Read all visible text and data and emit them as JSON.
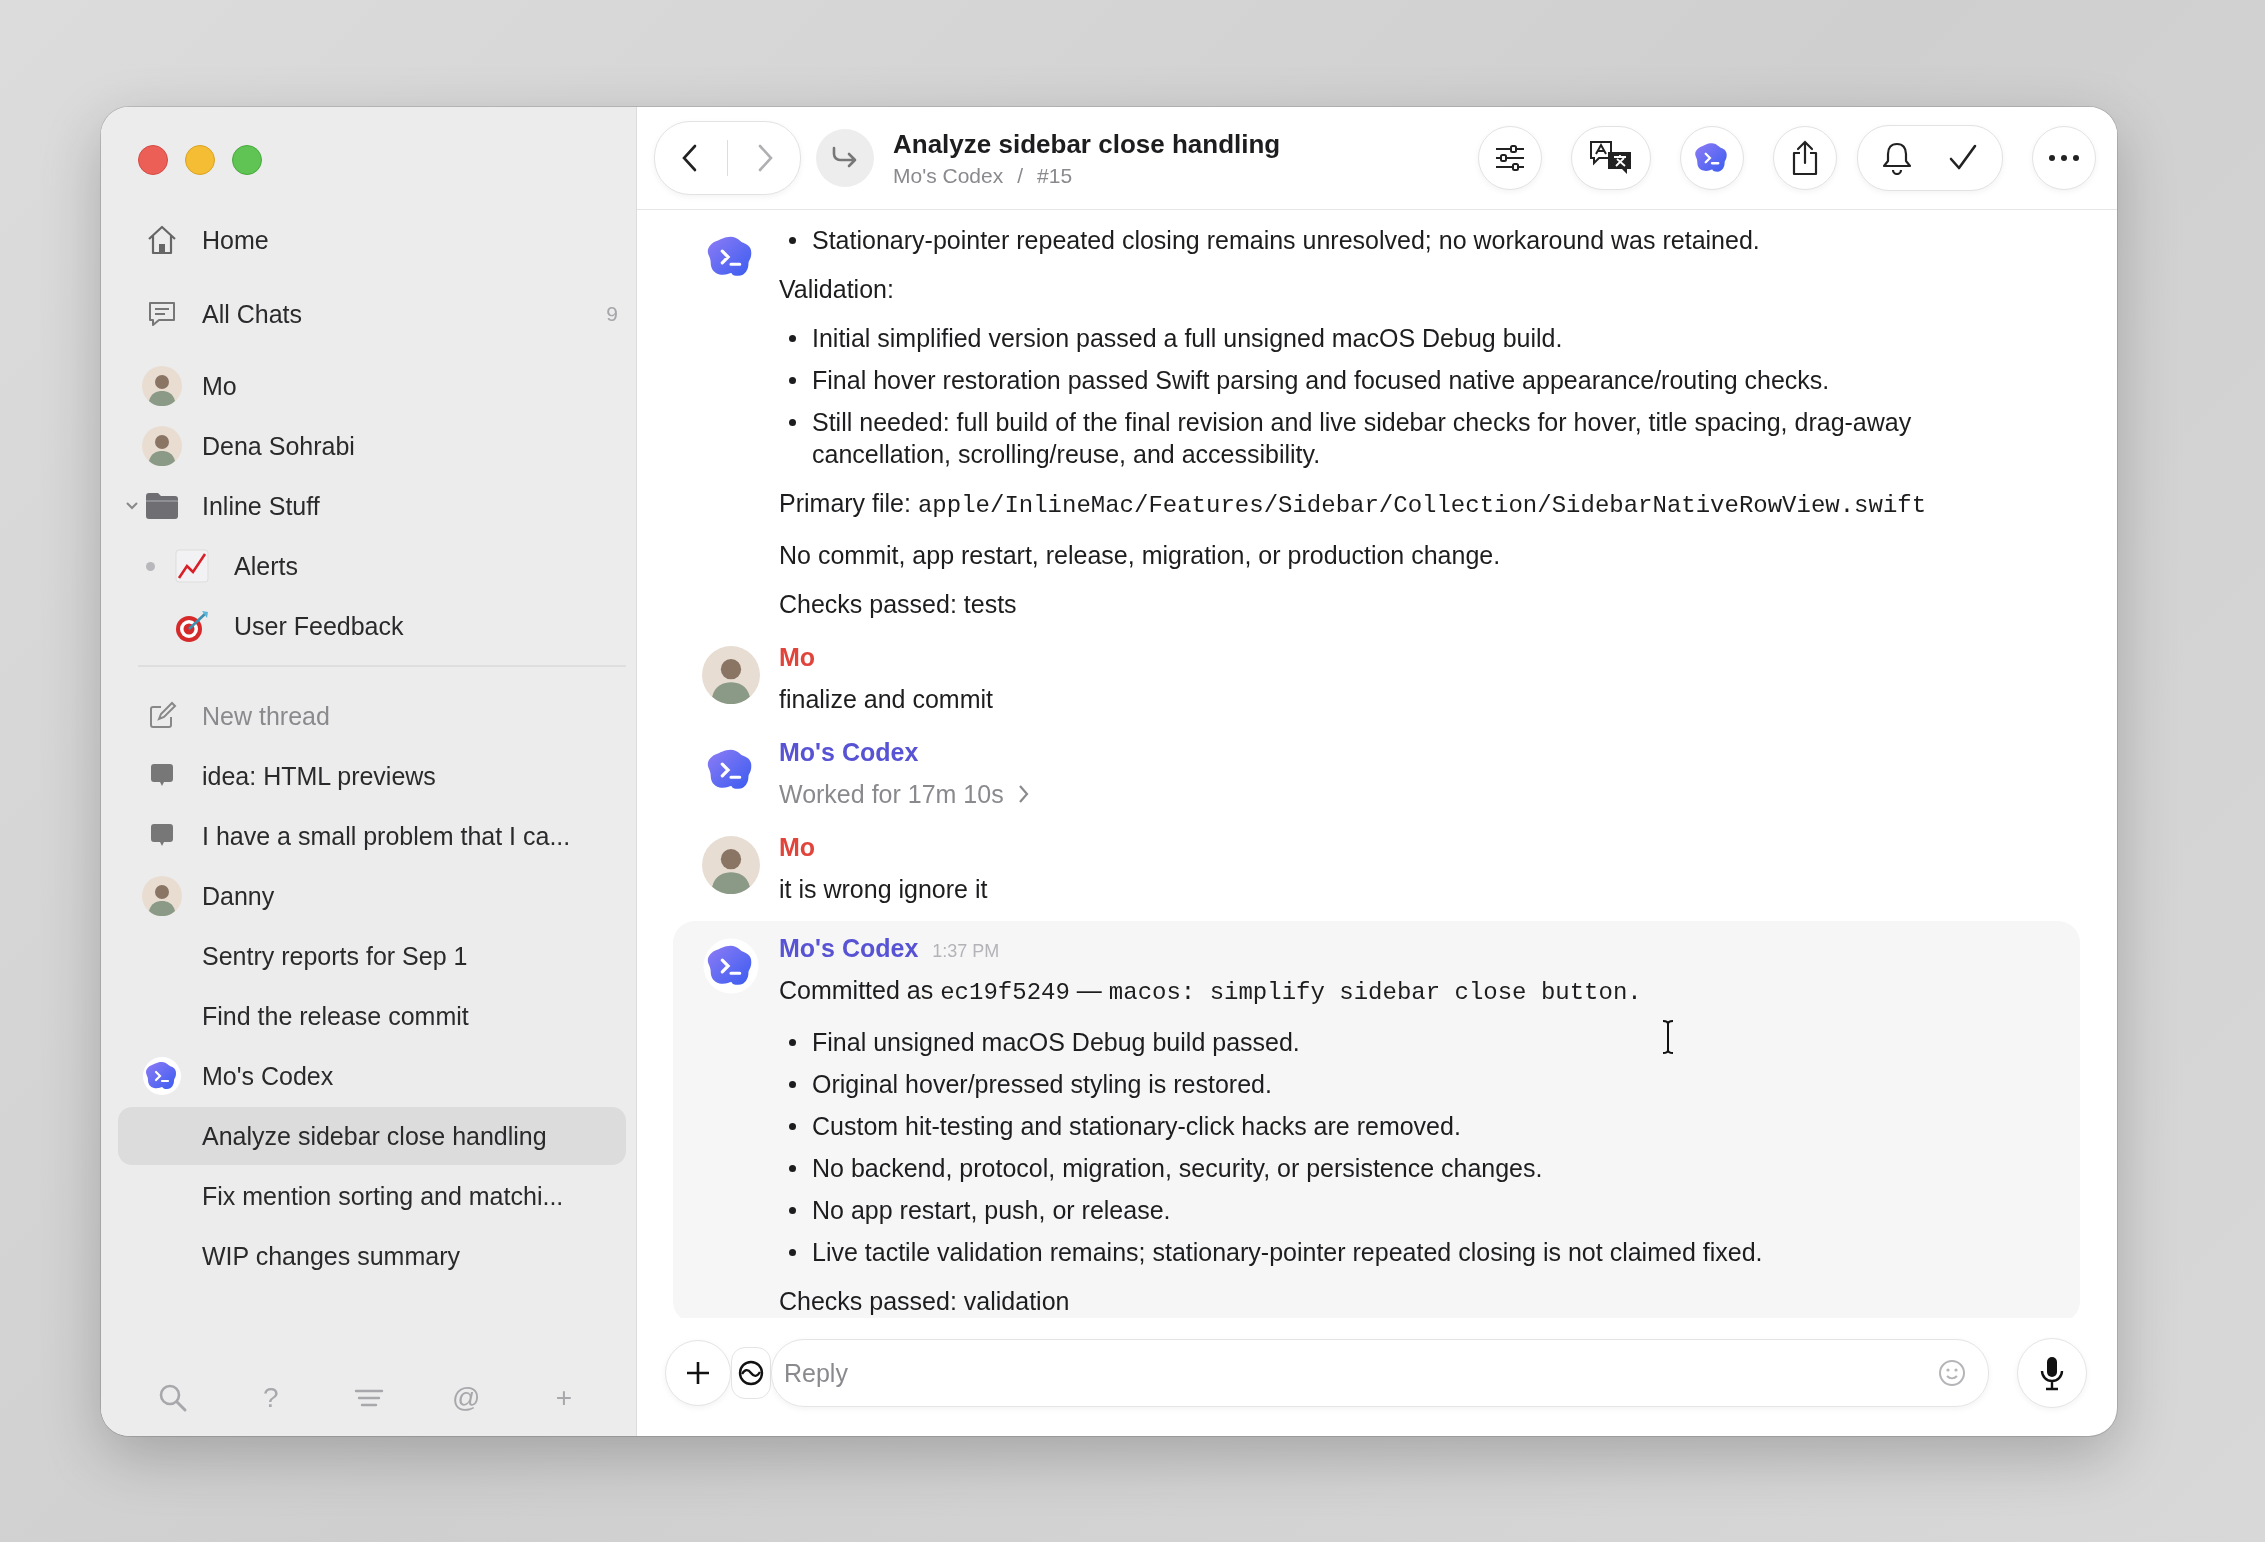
{
  "sidebar": {
    "nav": [
      {
        "kind": "home",
        "label": "Home"
      },
      {
        "kind": "chats",
        "label": "All Chats",
        "count": "9"
      }
    ],
    "spaces": [
      {
        "kind": "person",
        "label": "Mo"
      },
      {
        "kind": "person",
        "label": "Dena Sohrabi"
      },
      {
        "kind": "folder",
        "label": "Inline Stuff",
        "expanded": true,
        "children": [
          {
            "kind": "chart",
            "label": "Alerts",
            "unread": true
          },
          {
            "kind": "target",
            "label": "User Feedback",
            "unread": false
          }
        ]
      }
    ],
    "threads": [
      {
        "kind": "compose",
        "label": "New thread",
        "selected": false
      },
      {
        "kind": "thread",
        "label": "idea: HTML previews",
        "selected": false
      },
      {
        "kind": "thread",
        "label": "I have a small problem that I ca...",
        "selected": false
      },
      {
        "kind": "person",
        "label": "Danny",
        "selected": false,
        "children": [
          {
            "label": "Sentry reports for Sep 1",
            "selected": false
          },
          {
            "label": "Find the release commit",
            "selected": false
          }
        ]
      },
      {
        "kind": "bot",
        "label": "Mo's Codex",
        "selected": false,
        "children": [
          {
            "label": "Analyze sidebar close handling",
            "selected": true
          },
          {
            "label": "Fix mention sorting and matchi...",
            "selected": false
          },
          {
            "label": "WIP changes summary",
            "selected": false
          }
        ]
      }
    ],
    "footer": [
      {
        "kind": "search"
      },
      {
        "kind": "glyph",
        "label": "?"
      },
      {
        "kind": "filter"
      },
      {
        "kind": "glyph",
        "label": "@"
      },
      {
        "kind": "glyph",
        "label": "+"
      }
    ]
  },
  "header": {
    "can_go_back": true,
    "can_go_forward": false,
    "title": "Analyze sidebar close handling",
    "space": "Mo's Codex",
    "separator": "/",
    "thread_number": "#15",
    "toolbar": [
      {
        "kind": "filters"
      },
      {
        "kind": "translate"
      },
      {
        "kind": "bot"
      },
      {
        "kind": "share"
      },
      {
        "kind": "group",
        "items": [
          {
            "kind": "bell"
          },
          {
            "kind": "check"
          }
        ]
      },
      {
        "kind": "more"
      }
    ]
  },
  "messages": [
    {
      "kind": "bot",
      "highlighted": false,
      "blocks": [
        {
          "kind": "bullets",
          "items": [
            "Stationary-pointer repeated closing remains unresolved; no workaround was retained."
          ]
        },
        {
          "kind": "para",
          "text": "Validation:"
        },
        {
          "kind": "bullets",
          "items": [
            "Initial simplified version passed a full unsigned macOS Debug build.",
            "Final hover restoration passed Swift parsing and focused native appearance/routing checks.",
            "Still needed: full build of the final revision and live sidebar checks for hover, title spacing, drag-away cancellation, scrolling/reuse, and accessibility."
          ]
        },
        {
          "kind": "file",
          "label": "Primary file:",
          "path": "apple/InlineMac/Features/Sidebar/Collection/SidebarNativeRowView.swift"
        },
        {
          "kind": "para",
          "text": "No commit, app restart, release, migration, or production change."
        },
        {
          "kind": "para",
          "text": "Checks passed: tests"
        }
      ]
    },
    {
      "kind": "person",
      "author": "Mo",
      "color": "#e0443a",
      "highlighted": false,
      "blocks": [
        {
          "kind": "para",
          "text": "finalize and commit"
        }
      ]
    },
    {
      "kind": "bot",
      "author": "Mo's Codex",
      "color": "#5753d4",
      "highlighted": false,
      "blocks": [
        {
          "kind": "work",
          "text": "Worked for 17m 10s"
        }
      ]
    },
    {
      "kind": "person",
      "author": "Mo",
      "color": "#e0443a",
      "highlighted": false,
      "blocks": [
        {
          "kind": "para",
          "text": "it is wrong ignore it"
        }
      ]
    },
    {
      "kind": "bot",
      "author": "Mo's Codex",
      "color": "#5753d4",
      "time": "1:37 PM",
      "highlighted": true,
      "blocks": [
        {
          "kind": "commit",
          "label": "Committed as",
          "hash": "ec19f5249",
          "separator": "—",
          "subject": "macos: simplify sidebar close button."
        },
        {
          "kind": "bullets",
          "items": [
            "Final unsigned macOS Debug build passed.",
            "Original hover/pressed styling is restored.",
            "Custom hit-testing and stationary-click hacks are removed.",
            "No backend, protocol, migration, security, or persistence changes.",
            "No app restart, push, or release.",
            "Live tactile validation remains; stationary-pointer repeated closing is not claimed fixed."
          ]
        },
        {
          "kind": "para",
          "text": "Checks passed: validation"
        }
      ]
    }
  ],
  "composer": {
    "placeholder": "Reply"
  }
}
